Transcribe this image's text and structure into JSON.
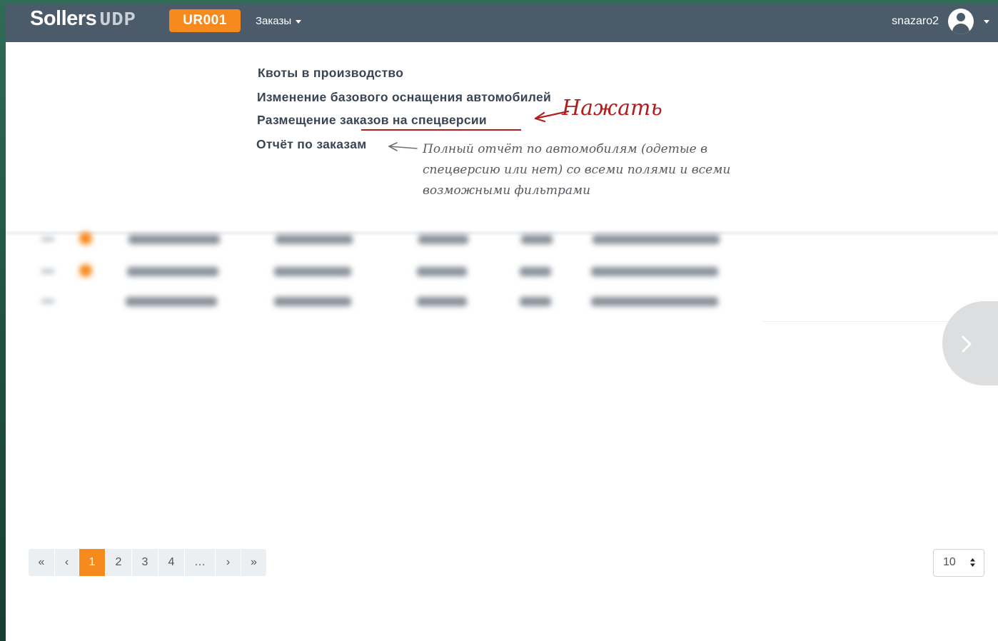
{
  "navbar": {
    "logo_main": "Sollers",
    "logo_sub": "UDP",
    "dealer_code": "UR001",
    "menu_label": "Заказы",
    "username": "snazaro2"
  },
  "menu": {
    "items": [
      {
        "label": "Квоты в производство"
      },
      {
        "label": "Изменение базового оснащения автомобилей"
      },
      {
        "label": "Размещение заказов на спецверсии"
      },
      {
        "label": "Отчёт по заказам"
      }
    ]
  },
  "annotations": {
    "click_note": "Нажать",
    "report_note": "Полный отчёт по автомобилям (одетые в спецверсию или нет) со всеми полями и всеми возможными фильтрами"
  },
  "pagination": {
    "first": "«",
    "prev": "‹",
    "pages": [
      "1",
      "2",
      "3",
      "4"
    ],
    "ellipsis": "…",
    "next": "›",
    "last": "»",
    "current_page": "1"
  },
  "page_size": {
    "value": "10"
  },
  "colors": {
    "navbar": "#4b5b6a",
    "accent": "#f78a1d",
    "annotation_red": "#b01e1e"
  },
  "icons": {
    "user": "user-circle-icon",
    "next": "chevron-right-icon",
    "select": "sort-arrows-icon"
  }
}
